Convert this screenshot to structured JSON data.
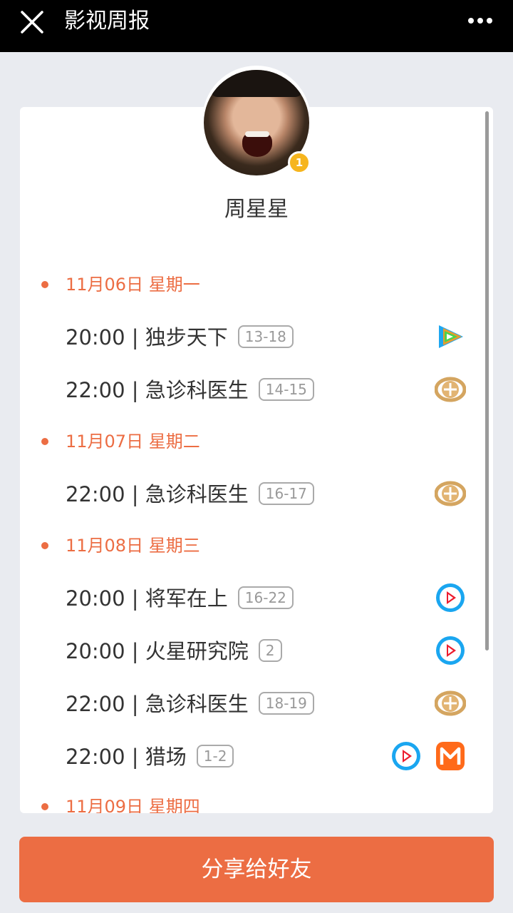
{
  "header": {
    "title": "影视周报"
  },
  "profile": {
    "name": "周星星",
    "badge": "1"
  },
  "days": [
    {
      "label": "11月06日 星期一",
      "shows": [
        {
          "time": "20:00 | 独步天下",
          "episodes": "13-18",
          "platforms": [
            "tencent-video-icon"
          ]
        },
        {
          "time": "22:00 | 急诊科医生",
          "episodes": "14-15",
          "platforms": [
            "quanwang-icon"
          ]
        }
      ]
    },
    {
      "label": "11月07日 星期二",
      "shows": [
        {
          "time": "22:00 | 急诊科医生",
          "episodes": "16-17",
          "platforms": [
            "quanwang-icon"
          ]
        }
      ]
    },
    {
      "label": "11月08日 星期三",
      "shows": [
        {
          "time": "20:00 | 将军在上",
          "episodes": "16-22",
          "platforms": [
            "youku-icon"
          ]
        },
        {
          "time": "20:00 | 火星研究院",
          "episodes": "2",
          "platforms": [
            "youku-icon"
          ]
        },
        {
          "time": "22:00 | 急诊科医生",
          "episodes": "18-19",
          "platforms": [
            "quanwang-icon"
          ]
        },
        {
          "time": "22:00 | 猎场",
          "episodes": "1-2",
          "platforms": [
            "youku-icon",
            "mgtv-icon"
          ]
        }
      ]
    },
    {
      "label": "11月09日 星期四",
      "shows": []
    }
  ],
  "footer": {
    "share_label": "分享给好友"
  },
  "colors": {
    "accent": "#ec6d43",
    "topbar": "#000000",
    "background": "#e9ebf0"
  }
}
